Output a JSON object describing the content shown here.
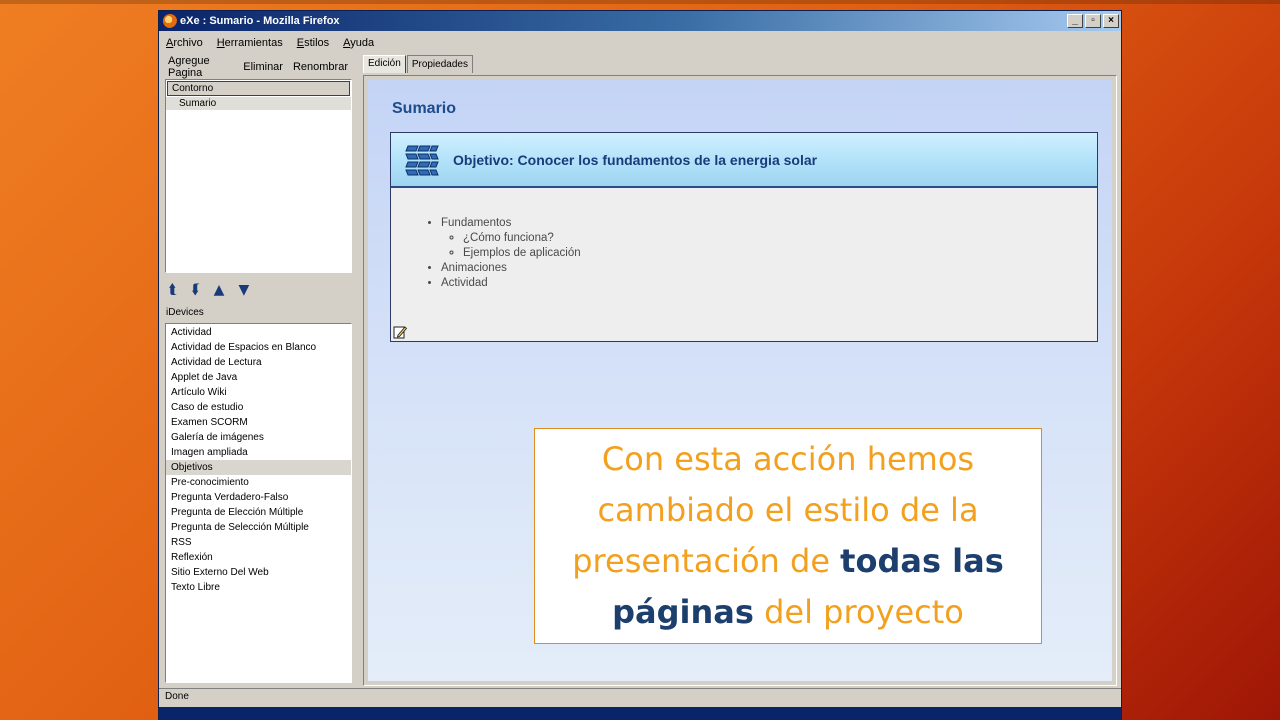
{
  "window": {
    "title": "eXe : Sumario - Mozilla Firefox",
    "controls": [
      "_",
      "▫",
      "×"
    ]
  },
  "menu": [
    "Archivo",
    "Herramientas",
    "Estilos",
    "Ayuda"
  ],
  "left_toolbar": [
    "Agregue Pagina",
    "Eliminar",
    "Renombrar"
  ],
  "outline": {
    "header": "Contorno",
    "items": [
      "Sumario"
    ]
  },
  "nav_arrows": [
    "⮬",
    "⮮",
    "▲",
    "▼"
  ],
  "idevices": {
    "label": "iDevices",
    "items": [
      "Actividad",
      "Actividad de Espacios en Blanco",
      "Actividad de Lectura",
      "Applet de Java",
      "Artículo Wiki",
      "Caso de estudio",
      "Examen SCORM",
      "Galería de imágenes",
      "Imagen ampliada",
      "Objetivos",
      "Pre-conocimiento",
      "Pregunta Verdadero-Falso",
      "Pregunta de Elección Múltiple",
      "Pregunta de Selección Múltiple",
      "RSS",
      "Reflexión",
      "Sitio Externo Del Web",
      "Texto Libre"
    ],
    "selected": "Objetivos"
  },
  "tabs": [
    {
      "label": "Edición",
      "active": true
    },
    {
      "label": "Propiedades",
      "active": false
    }
  ],
  "page": {
    "title": "Sumario",
    "idevice_title": "Objetivo: Conocer los fundamentos de la energia solar",
    "list": {
      "item1": "Fundamentos",
      "sub1": "¿Cómo funciona?",
      "sub2": "Ejemplos de aplicación",
      "item2": "Animaciones",
      "item3": "Actividad"
    }
  },
  "status": "Done",
  "callout": {
    "text_a": "Con esta acción hemos cambiado el estilo de la presentación de ",
    "emph_1": "todas las páginas",
    "text_b": " del proyecto"
  },
  "colors": {
    "accent": "#f2a01e",
    "emphasis": "#1d3f6e",
    "title_blue": "#1e4b8c"
  }
}
